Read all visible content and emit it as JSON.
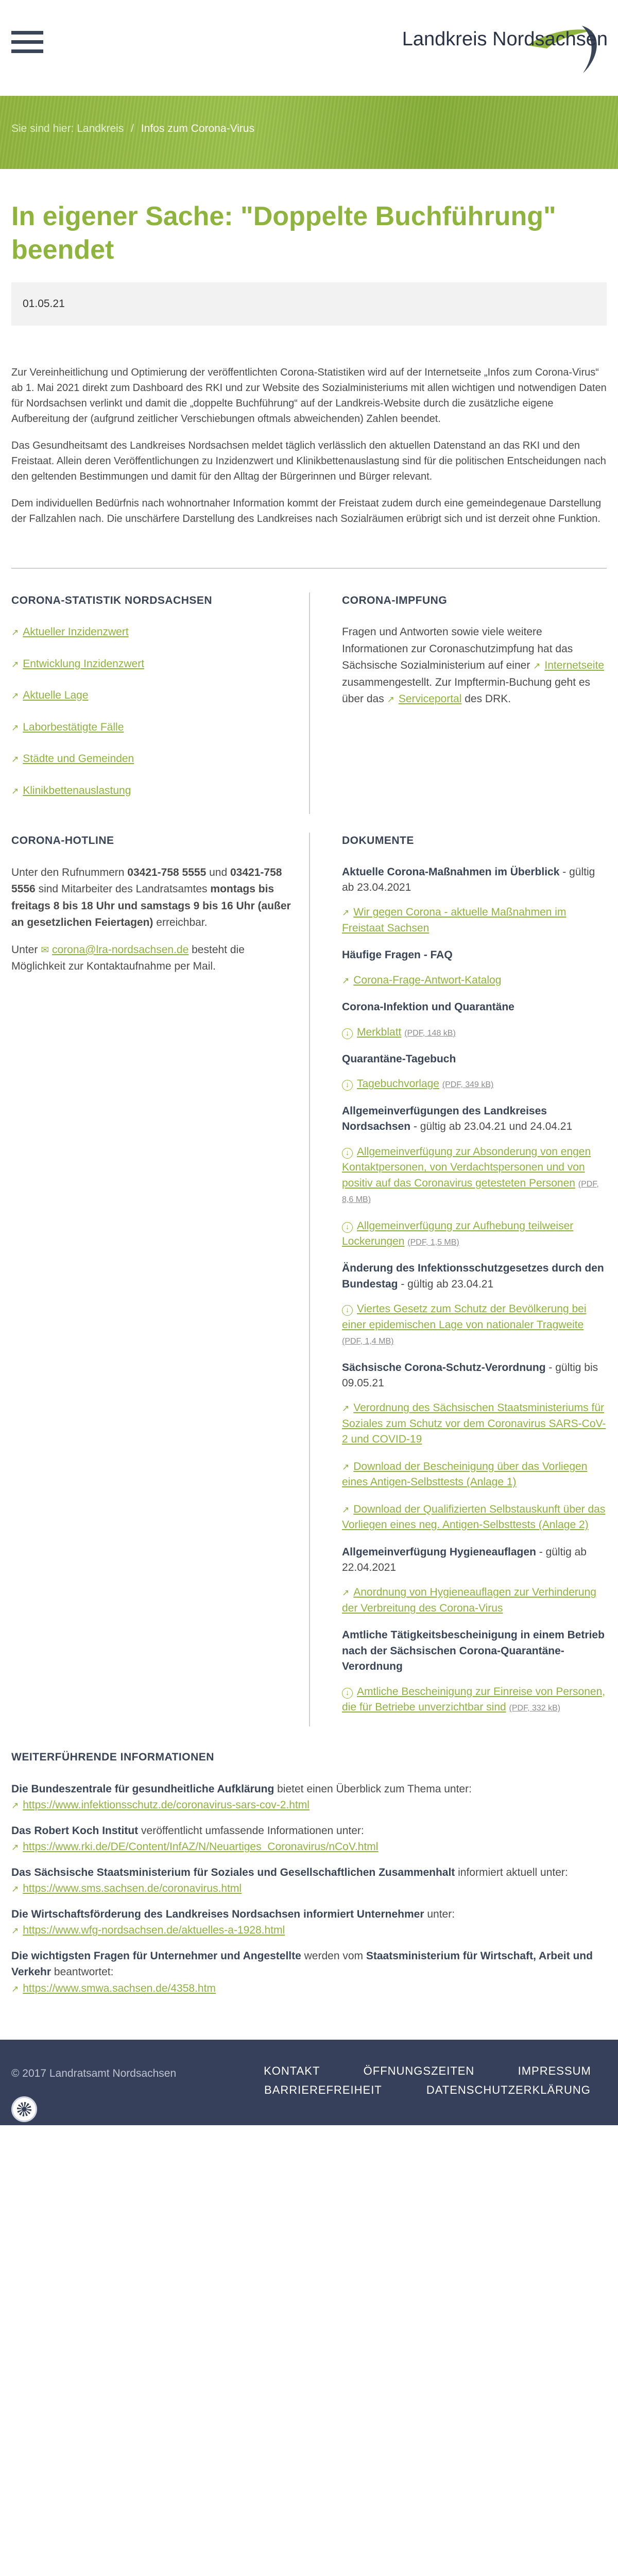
{
  "header": {
    "menu_icon": "hamburger-menu-icon",
    "logo_text": "Landkreis Nordsachsen",
    "colors": {
      "accent": "#8fb43e",
      "dark": "#36405a",
      "navy": "#3a4558"
    }
  },
  "breadcrumb": {
    "prefix": "Sie sind hier:",
    "home": "Landkreis",
    "separator": "/",
    "current": "Infos zum Corona-Virus"
  },
  "article": {
    "title": "In eigener Sache: \"Doppelte Buchführung\" beendet",
    "date": "01.05.21",
    "paragraphs": [
      "Zur Vereinheitlichung und Optimierung der veröffentlichten Corona-Statistiken wird auf der Internetseite „Infos zum Corona-Virus“ ab 1. Mai 2021 direkt zum Dashboard des RKI und zur Website des Sozialministeriums mit allen wichtigen und notwendigen Daten für Nordsachsen verlinkt und damit die „doppelte Buchführung“ auf der Landkreis-Website durch die zusätzliche eigene Aufbereitung der (aufgrund zeitlicher Verschiebungen oftmals abweichenden) Zahlen beendet.",
      "Das Gesundheitsamt des Landkreises Nordsachsen meldet täglich verlässlich den aktuellen Datenstand an das RKI und den Freistaat. Allein deren Veröffentlichungen zu Inzidenzwert und Klinikbettenauslastung sind für die politischen Entscheidungen nach den geltenden Bestimmungen und damit für den Alltag der Bürgerinnen und Bürger relevant.",
      "Dem individuellen Bedürfnis nach wohnortnaher Information kommt der Freistaat zudem durch eine gemeindegenaue Darstellung der Fallzahlen nach. Die unschärfere Darstellung des Landkreises nach Sozialräumen erübrigt sich und ist derzeit ohne Funktion."
    ]
  },
  "statistik": {
    "heading": "CORONA-STATISTIK NORDSACHSEN",
    "links": [
      "Aktueller Inzidenzwert",
      "Entwicklung Inzidenzwert",
      "Aktuelle Lage",
      "Laborbestätigte Fälle",
      "Städte und Gemeinden",
      "Klinikbettenauslastung"
    ]
  },
  "impfung": {
    "heading": "CORONA-IMPFUNG",
    "text1": "Fragen und Antworten sowie viele weitere Informationen zur Coronaschutzimpfung hat das Sächsische Sozialministerium auf einer",
    "link1": "Internetseite",
    "text2": "zusammengestellt. Zur Impftermin-Buchung geht es über das",
    "link2": "Serviceportal",
    "text3": "des DRK."
  },
  "hotline": {
    "heading": "CORONA-HOTLINE",
    "p1_a": "Unter den Rufnummern",
    "phone1": "03421-758 5555",
    "p1_b": "und",
    "phone2": "03421-758 5556",
    "p1_c": "sind Mitarbeiter des Landratsamtes",
    "hours": "montags bis freitags 8 bis 18 Uhr und samstags 9 bis 16 Uhr (außer an gesetzlichen Feiertagen)",
    "p1_d": "erreichbar.",
    "p2_a": "Unter",
    "email": "corona@lra-nordsachsen.de",
    "p2_b": "besteht die Möglichkeit zur Kontaktaufnahme per Mail."
  },
  "dokumente": {
    "heading": "DOKUMENTE",
    "groups": [
      {
        "title": "Aktuelle Corona-Maßnahmen im Überblick",
        "suffix": " - gültig ab 23.04.2021",
        "items": [
          {
            "kind": "ext",
            "label": "Wir gegen Corona - aktuelle Maßnahmen im Freistaat Sachsen",
            "meta": ""
          }
        ]
      },
      {
        "title": "Häufige Fragen - FAQ",
        "suffix": "",
        "items": [
          {
            "kind": "ext",
            "label": "Corona-Frage-Antwort-Katalog",
            "meta": ""
          }
        ]
      },
      {
        "title": "Corona-Infektion und Quarantäne",
        "suffix": "",
        "items": [
          {
            "kind": "dl",
            "label": "Merkblatt",
            "meta": "(PDF, 148 kB)"
          }
        ]
      },
      {
        "title": "Quarantäne-Tagebuch",
        "suffix": "",
        "items": [
          {
            "kind": "dl",
            "label": "Tagebuchvorlage",
            "meta": "(PDF, 349 kB)"
          }
        ]
      },
      {
        "title": "Allgemeinverfügungen des Landkreises Nordsachsen",
        "suffix": " - gültig ab 23.04.21 und 24.04.21",
        "items": [
          {
            "kind": "dl",
            "label": "Allgemeinverfügung zur Absonderung von engen Kontaktpersonen, von Verdachtspersonen und von positiv auf das Coronavirus getesteten Personen",
            "meta": "(PDF, 8,6 MB)"
          },
          {
            "kind": "dl",
            "label": "Allgemeinverfügung zur Aufhebung teilweiser Lockerungen",
            "meta": "(PDF, 1,5 MB)"
          }
        ]
      },
      {
        "title": "Änderung des Infektionsschutzgesetzes durch den Bundestag",
        "suffix": " - gültig ab 23.04.21",
        "items": [
          {
            "kind": "dl",
            "label": "Viertes Gesetz zum Schutz der Bevölkerung bei einer epidemischen Lage von nationaler Tragweite",
            "meta": "(PDF, 1,4 MB)"
          }
        ]
      },
      {
        "title": "Sächsische Corona-Schutz-Verordnung",
        "suffix": " - gültig bis 09.05.21",
        "items": [
          {
            "kind": "ext",
            "label": "Verordnung des Sächsischen Staatsministeriums für Soziales zum Schutz vor dem Coronavirus SARS-CoV-2 und COVID-19",
            "meta": ""
          },
          {
            "kind": "ext",
            "label": "Download der Bescheinigung über das Vorliegen eines Antigen-Selbsttests (Anlage 1)",
            "meta": ""
          },
          {
            "kind": "ext",
            "label": "Download der Qualifizierten Selbstauskunft über das Vorliegen eines neg. Antigen-Selbsttests (Anlage 2)",
            "meta": ""
          }
        ]
      },
      {
        "title": "Allgemeinverfügung Hygieneauflagen",
        "suffix": " - gültig ab 22.04.2021",
        "items": [
          {
            "kind": "ext",
            "label": "Anordnung von Hygieneauflagen zur Verhinderung der Verbreitung des Corona-Virus",
            "meta": ""
          }
        ]
      },
      {
        "title": "Amtliche Tätigkeitsbescheinigung in einem Betrieb nach der Sächsischen Corona-Quarantäne-Verordnung",
        "suffix": "",
        "items": [
          {
            "kind": "dl",
            "label": "Amtliche Bescheinigung zur Einreise von Personen, die für Betriebe unverzichtbar sind",
            "meta": "(PDF, 332 kB)"
          }
        ]
      }
    ]
  },
  "weiter": {
    "heading": "WEITERFÜHRENDE INFORMATIONEN",
    "entries": [
      {
        "bold": "Die Bundeszentrale für gesundheitliche Aufklärung",
        "text": " bietet einen Überblick zum Thema unter:",
        "url": "https://www.infektionsschutz.de/coronavirus-sars-cov-2.html"
      },
      {
        "bold": "Das Robert Koch Institut",
        "text": " veröffentlicht umfassende Informationen unter:",
        "url": "https://www.rki.de/DE/Content/InfAZ/N/Neuartiges_Coronavirus/nCoV.html"
      },
      {
        "bold": "Das Sächsische Staatsministerium für Soziales und Gesellschaftlichen Zusammenhalt",
        "text": " informiert aktuell unter:",
        "url": "https://www.sms.sachsen.de/coronavirus.html"
      },
      {
        "bold": "Die Wirtschaftsförderung des Landkreises Nordsachsen informiert Unternehmer",
        "text": " unter:",
        "url": "https://www.wfg-nordsachsen.de/aktuelles-a-1928.html"
      },
      {
        "bold": "Die wichtigsten Fragen für Unternehmer und Angestellte",
        "text": " werden vom ",
        "bold2": "Staatsministerium für Wirtschaft, Arbeit und Verkehr",
        "text2": " beantwortet:",
        "url": "https://www.smwa.sachsen.de/4358.htm"
      }
    ]
  },
  "footer": {
    "copyright": "© 2017 Landratsamt Nordsachsen",
    "nav": [
      "KONTAKT",
      "ÖFFNUNGSZEITEN",
      "IMPRESSUM",
      "BARRIEREFREIHEIT",
      "DATENSCHUTZERKLÄRUNG"
    ],
    "badge_icon": "accessibility-badge-icon"
  }
}
